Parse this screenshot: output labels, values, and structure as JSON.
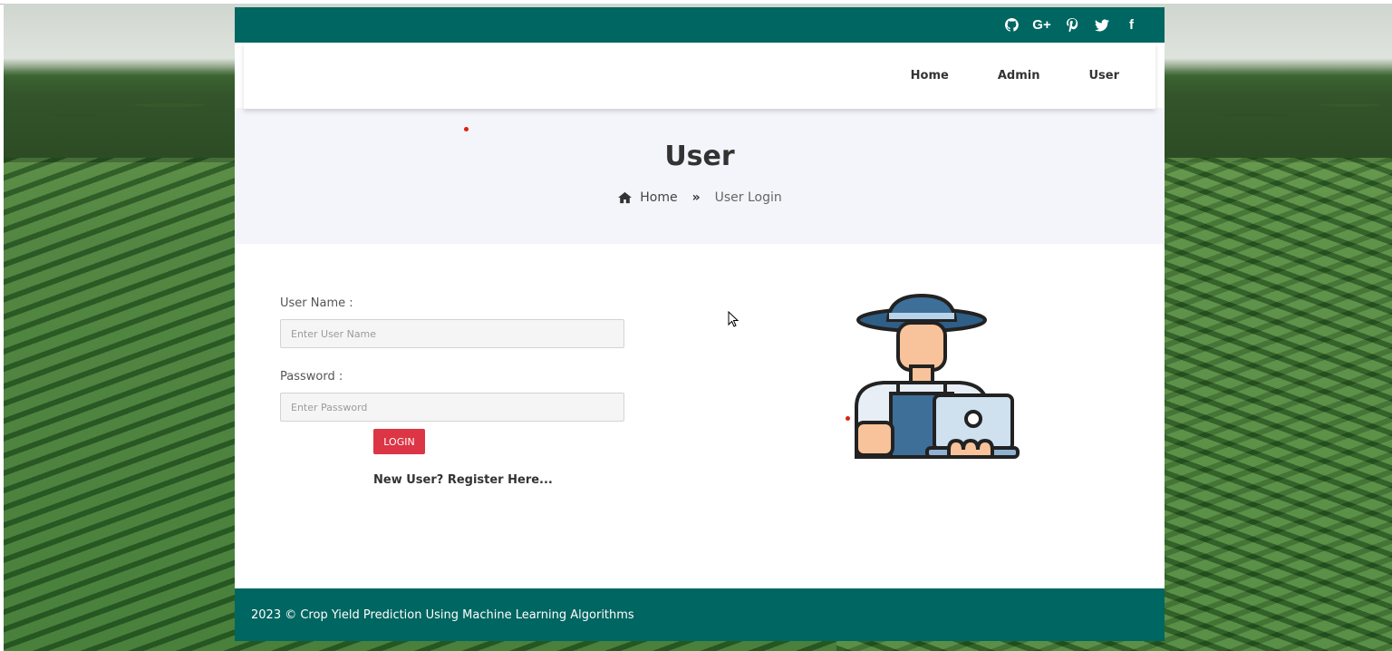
{
  "social": {
    "github": "github-icon",
    "google_plus": "G+",
    "pinterest": "pinterest-icon",
    "twitter": "twitter-icon",
    "facebook": "f"
  },
  "nav": {
    "items": [
      "Home",
      "Admin",
      "User"
    ]
  },
  "hero": {
    "title": "User",
    "breadcrumb": {
      "home": "Home",
      "current": "User Login"
    }
  },
  "form": {
    "username_label": "User Name :",
    "username_placeholder": "Enter User Name",
    "password_label": "Password :",
    "password_placeholder": "Enter Password",
    "login_label": "LOGIN",
    "register_label": "New User? Register Here..."
  },
  "footer": {
    "text": "2023 © Crop Yield Prediction Using Machine Learning Algorithms"
  },
  "colors": {
    "brand": "#006661",
    "accent": "#dc3545",
    "hero_bg": "#f4f5fb"
  }
}
